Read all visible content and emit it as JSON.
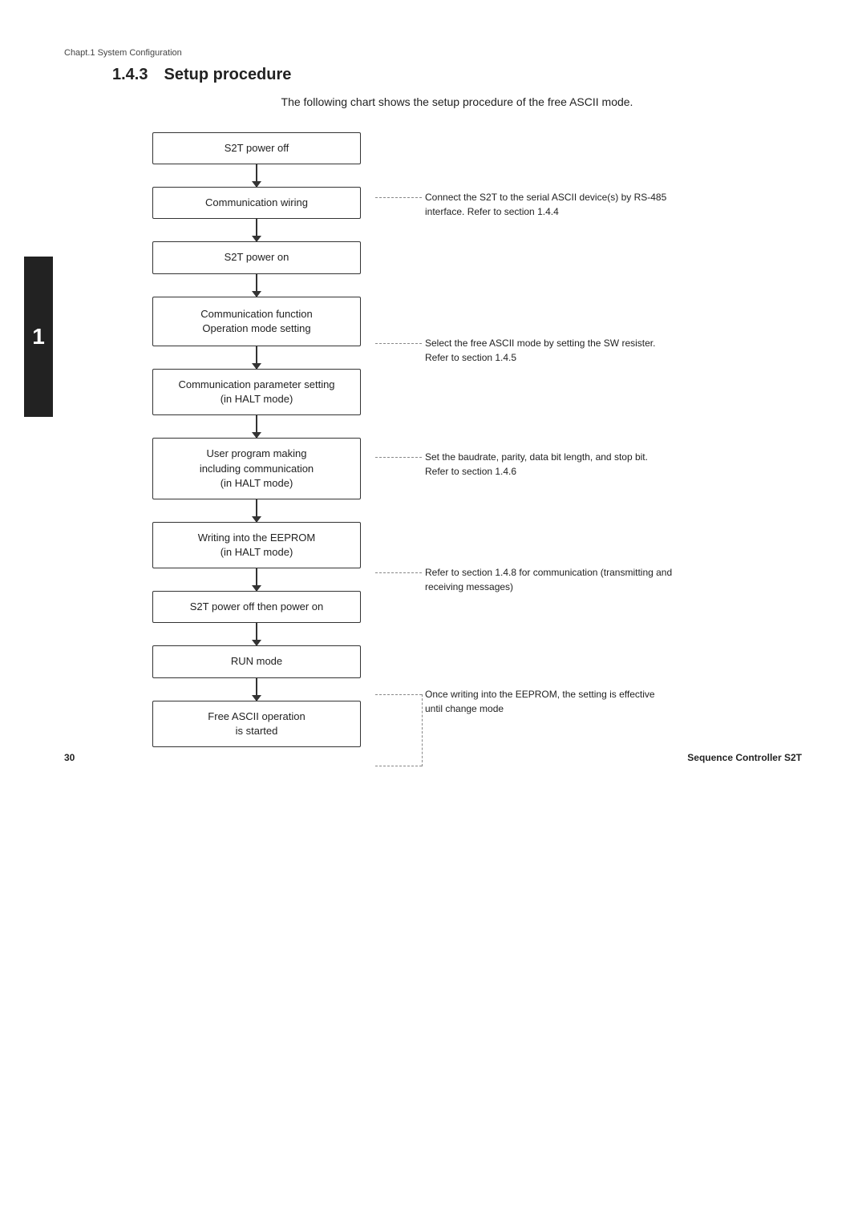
{
  "breadcrumb": "Chapt.1  System Configuration",
  "section_number": "1.4.3",
  "section_title": "Setup procedure",
  "subtitle": "The following chart shows the setup procedure of the free ASCII mode.",
  "sidebar_number": "1",
  "flowchart_steps": [
    {
      "id": "step1",
      "label": "S2T power off"
    },
    {
      "id": "step2",
      "label": "Communication wiring"
    },
    {
      "id": "step3",
      "label": "S2T power on"
    },
    {
      "id": "step4",
      "label": "Communication function\nOperation mode setting"
    },
    {
      "id": "step5",
      "label": "Communication parameter setting\n(in HALT mode)"
    },
    {
      "id": "step6",
      "label": "User program making\nincluding communication\n(in HALT mode)"
    },
    {
      "id": "step7",
      "label": "Writing into the EEPROM\n(in HALT mode)"
    },
    {
      "id": "step8",
      "label": "S2T power off then power on"
    },
    {
      "id": "step9",
      "label": "RUN mode"
    },
    {
      "id": "step10",
      "label": "Free ASCII operation\nis started"
    }
  ],
  "notes": [
    {
      "id": "note2",
      "text": "Connect the S2T to the serial ASCII device(s)   by RS-485 interface. Refer to section 1.4.4"
    },
    {
      "id": "note4",
      "text": "Select the free ASCII mode by setting the SW resister. Refer to section 1.4.5"
    },
    {
      "id": "note5",
      "text": "Set the baudrate, parity, data bit length, and stop bit. Refer to section 1.4.6"
    },
    {
      "id": "note6",
      "text": "Refer to section 1.4.8 for communication (transmitting and receiving messages)"
    },
    {
      "id": "note7",
      "text": "Once writing into the EEPROM, the setting is effective until change mode"
    }
  ],
  "footer": {
    "page_number": "30",
    "product_name": "Sequence Controller S2T"
  }
}
